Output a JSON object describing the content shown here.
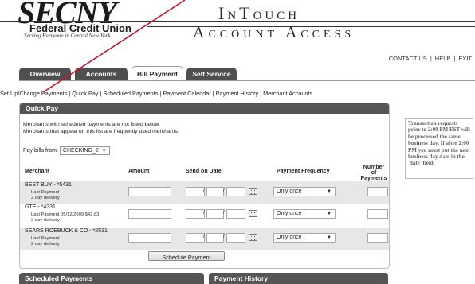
{
  "header": {
    "logo_main": "SECNY",
    "logo_sub": "Federal Credit Union",
    "logo_tagline": "Serving Everyone in Central New York",
    "brand_line1": "InTouch",
    "brand_line2": "Account Access"
  },
  "top_links": [
    "CONTACT US",
    "HELP",
    "EXIT"
  ],
  "tabs": [
    "Overview",
    "Accounts",
    "Bill Payment",
    "Self Service"
  ],
  "active_tab": "Bill Payment",
  "subnav": [
    "Set Up/Change Payments",
    "Quick Pay",
    "Scheduled Payments",
    "Payment Calendar",
    "Payment History",
    "Merchant Accounts"
  ],
  "quick_pay": {
    "title": "Quick Pay",
    "note_line1": "Merchants with scheduled payments are not listed below.",
    "note_line2": "Merchants that appear on this list are frequently used merchants.",
    "pay_bills_label": "Pay bills from:",
    "pay_bills_value": "CHECKING_2",
    "columns": {
      "merchant": "Merchant",
      "amount": "Amount",
      "send_on_date": "Send on Date",
      "payment_frequency": "Payment Frequency",
      "num_payments_1": "Number of",
      "num_payments_2": "Payments"
    },
    "rows": [
      {
        "merchant": "BEST BUY - *5431",
        "last_payment": "Last Payment",
        "delivery": "2 day delivery",
        "frequency": "Only once"
      },
      {
        "merchant": "GTE - *4331",
        "last_payment": "Last Payment  05/12/2009  $42.83",
        "delivery": "2 day delivery",
        "frequency": "Only once"
      },
      {
        "merchant": "SEARS ROEBUCK & CO - *2531",
        "last_payment": "Last Payment",
        "delivery": "2 day delivery",
        "frequency": "Only once"
      }
    ],
    "schedule_button": "Schedule Payment"
  },
  "side_note": "Transaction requests prior to 2:00 PM EST will be processed the same business day. If after 2:00 PM you must put the next business day date in the 'date' field.",
  "bottom_panels": [
    "Scheduled Payments",
    "Payment History"
  ],
  "colors": {
    "tab_bg": "#4f4f4f",
    "panel_header": "#555555",
    "row_shade": "#e7e7e7",
    "annotation": "#d0102a"
  }
}
